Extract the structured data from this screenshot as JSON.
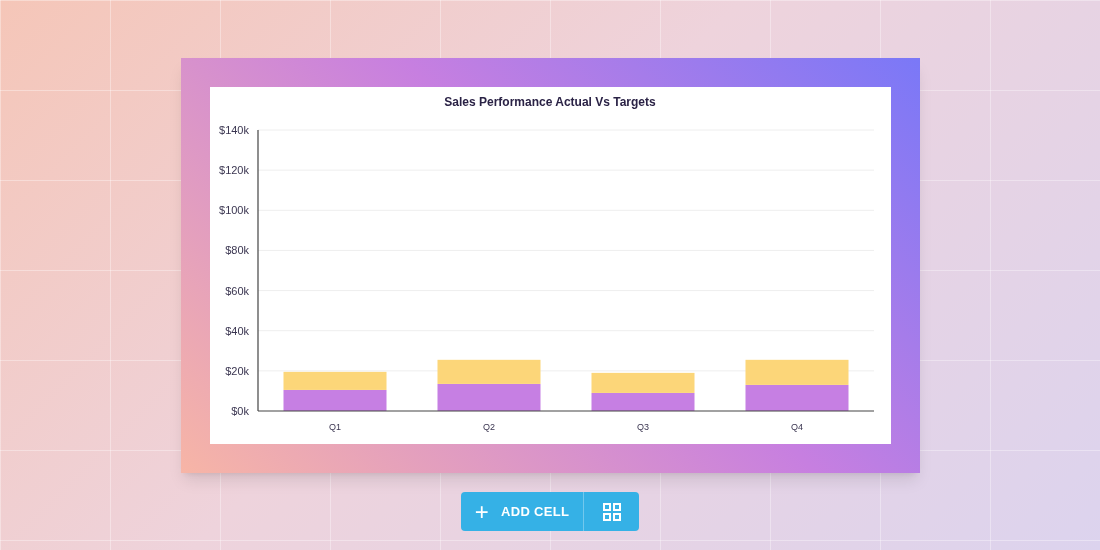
{
  "chart": {
    "chart_data": {
      "type": "bar",
      "title": "Sales Performance Actual Vs Targets",
      "categories": [
        "Q1",
        "Q2",
        "Q3",
        "Q4"
      ],
      "series": [
        {
          "color": "#c67fe3",
          "values": [
            10500,
            13500,
            9000,
            13000
          ]
        },
        {
          "color": "#fcd679",
          "values": [
            9000,
            12000,
            10000,
            12500
          ]
        }
      ],
      "stacked": true,
      "grid": true,
      "ylim": [
        0,
        140000
      ],
      "yticks": [
        {
          "value": 0,
          "label": "$0k"
        },
        {
          "value": 20000,
          "label": "$20k"
        },
        {
          "value": 40000,
          "label": "$40k"
        },
        {
          "value": 60000,
          "label": "$60k"
        },
        {
          "value": 80000,
          "label": "$80k"
        },
        {
          "value": 100000,
          "label": "$100k"
        },
        {
          "value": 120000,
          "label": "$120k"
        },
        {
          "value": 140000,
          "label": "$140k"
        }
      ]
    }
  },
  "toolbar": {
    "add_button": {
      "icon": "+",
      "label": "ADD CELL"
    }
  }
}
